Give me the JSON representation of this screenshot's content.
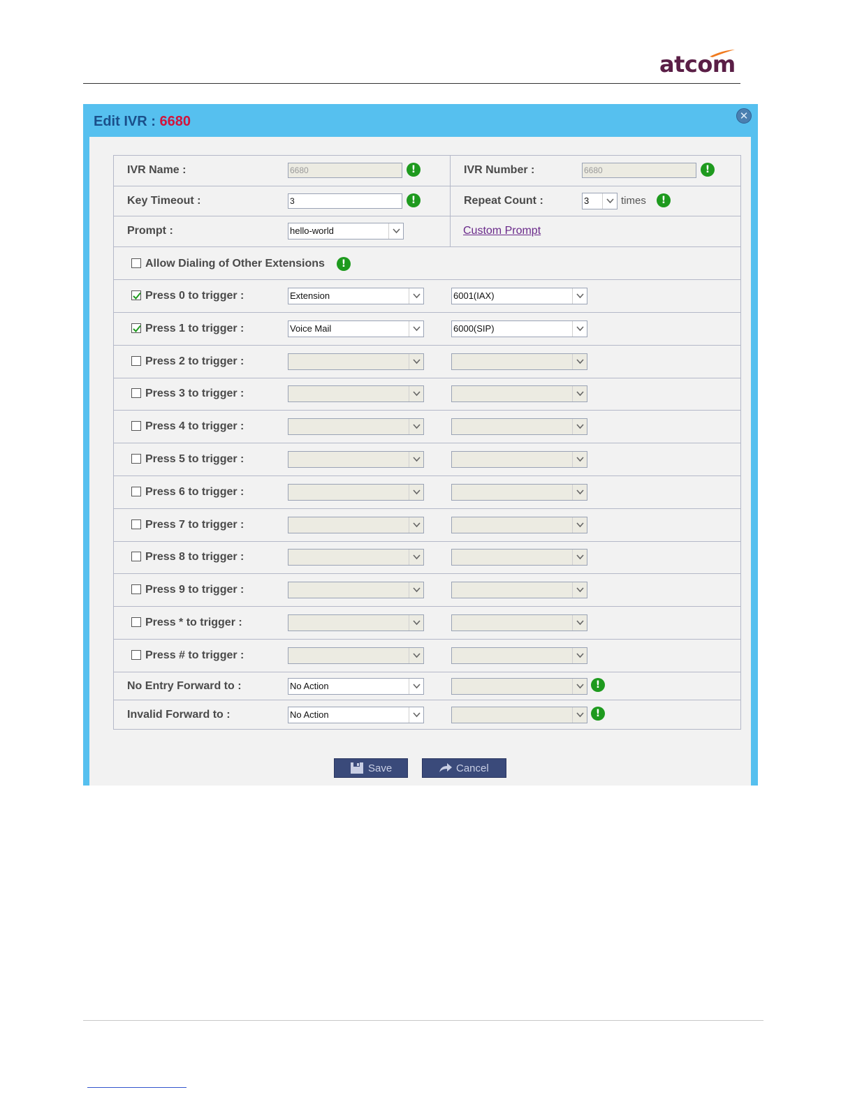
{
  "brand": {
    "logo_text": "atcom",
    "logo_color": "#5a1e46",
    "swoosh_color": "#f07a1e"
  },
  "dialog": {
    "title_prefix": "Edit IVR : ",
    "title_number": "6680",
    "close_icon": "close-icon",
    "header_color": "#56c0ef"
  },
  "fields": {
    "ivr_name": {
      "label": "IVR Name :",
      "value": "6680"
    },
    "ivr_number": {
      "label": "IVR Number :",
      "value": "6680"
    },
    "key_timeout": {
      "label": "Key Timeout :",
      "value": "3"
    },
    "repeat_count": {
      "label": "Repeat Count :",
      "value": "3",
      "suffix": "times"
    },
    "prompt": {
      "label": "Prompt :",
      "value": "hello-world",
      "custom_link": "Custom Prompt"
    },
    "allow_dialing": {
      "label": "Allow Dialing of Other Extensions",
      "checked": false
    }
  },
  "triggers": [
    {
      "label": "Press 0 to trigger :",
      "checked": true,
      "action": "Extension",
      "target": "6001(IAX)"
    },
    {
      "label": "Press 1 to trigger :",
      "checked": true,
      "action": "Voice Mail",
      "target": "6000(SIP)"
    },
    {
      "label": "Press 2 to trigger :",
      "checked": false,
      "action": "",
      "target": ""
    },
    {
      "label": "Press 3 to trigger :",
      "checked": false,
      "action": "",
      "target": ""
    },
    {
      "label": "Press 4 to trigger :",
      "checked": false,
      "action": "",
      "target": ""
    },
    {
      "label": "Press 5 to trigger :",
      "checked": false,
      "action": "",
      "target": ""
    },
    {
      "label": "Press 6 to trigger :",
      "checked": false,
      "action": "",
      "target": ""
    },
    {
      "label": "Press 7 to trigger :",
      "checked": false,
      "action": "",
      "target": ""
    },
    {
      "label": "Press 8 to trigger :",
      "checked": false,
      "action": "",
      "target": ""
    },
    {
      "label": "Press 9 to trigger :",
      "checked": false,
      "action": "",
      "target": ""
    },
    {
      "label": "Press * to trigger :",
      "checked": false,
      "action": "",
      "target": ""
    },
    {
      "label": "Press # to trigger :",
      "checked": false,
      "action": "",
      "target": ""
    }
  ],
  "forwards": {
    "no_entry": {
      "label": "No Entry Forward to :",
      "action": "No Action",
      "target": ""
    },
    "invalid": {
      "label": "Invalid Forward to :",
      "action": "No Action",
      "target": ""
    }
  },
  "buttons": {
    "save": "Save",
    "cancel": "Cancel"
  }
}
